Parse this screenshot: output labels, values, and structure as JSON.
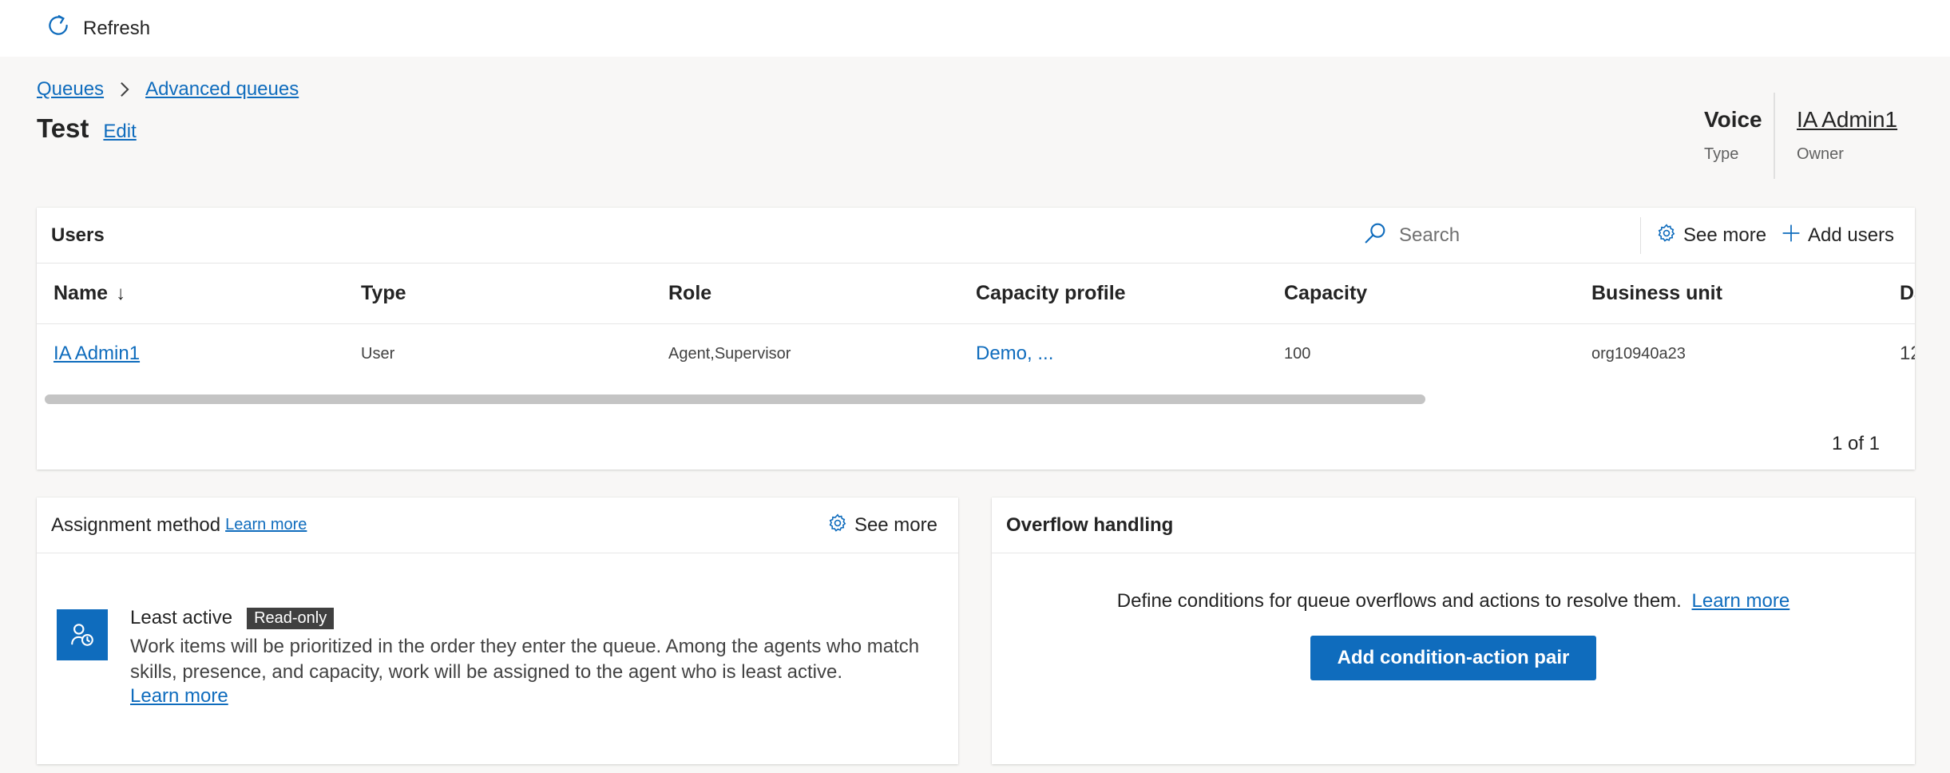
{
  "toolbar": {
    "refresh_label": "Refresh"
  },
  "breadcrumb": {
    "items": [
      "Queues",
      "Advanced queues"
    ]
  },
  "header": {
    "title": "Test",
    "edit_label": "Edit",
    "type_value": "Voice",
    "type_label": "Type",
    "owner_value": "IA Admin1",
    "owner_label": "Owner"
  },
  "users": {
    "title": "Users",
    "search_placeholder": "Search",
    "see_more_label": "See more",
    "add_users_label": "Add users",
    "columns": [
      "Name",
      "Type",
      "Role",
      "Capacity profile",
      "Capacity",
      "Business unit",
      "Da"
    ],
    "sort_indicator": "↓",
    "rows": [
      {
        "name": "IA Admin1",
        "type": "User",
        "role": "Agent,Supervisor",
        "capacity_profile": "Demo, ...",
        "capacity": "100",
        "business_unit": "org10940a23",
        "date": "12"
      }
    ],
    "horizontal_scroll_visible_fraction": 0.85,
    "pager": "1 of 1"
  },
  "assignment": {
    "title": "Assignment method",
    "learn_more_label": "Learn more",
    "see_more_label": "See more",
    "method_name": "Least active",
    "badge": "Read-only",
    "description": "Work items will be prioritized in the order they enter the queue. Among the agents who match skills, presence, and capacity, work will be assigned to the agent who is least active.",
    "method_learn_more": "Learn more"
  },
  "overflow": {
    "title": "Overflow handling",
    "description": "Define conditions for queue overflows and actions to resolve them.",
    "learn_more_label": "Learn more",
    "button_label": "Add condition-action pair"
  },
  "colors": {
    "accent": "#0f6cbd",
    "background": "#f8f7f6",
    "badge_bg": "#404040"
  },
  "icons": {
    "refresh": "refresh-icon",
    "chevron": "chevron-right-icon",
    "search": "search-icon",
    "gear": "gear-icon",
    "add": "plus-icon",
    "method": "person-clock-icon"
  }
}
